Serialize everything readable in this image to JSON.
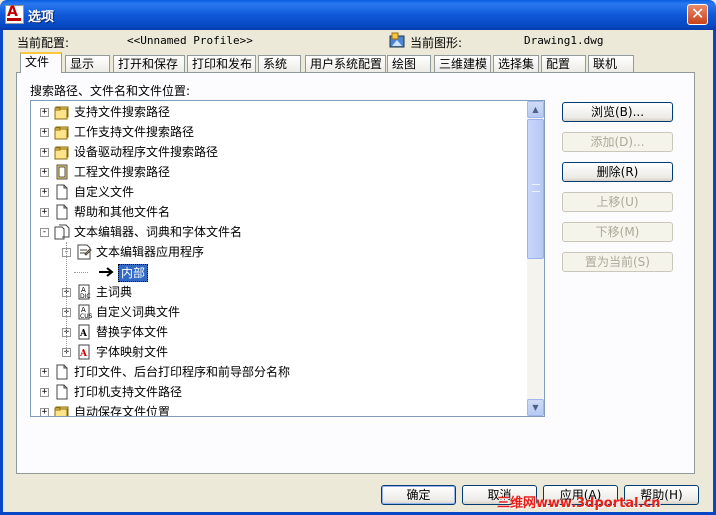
{
  "window": {
    "title": "选项"
  },
  "profile": {
    "label": "当前配置:",
    "value": "<<Unnamed Profile>>"
  },
  "drawing": {
    "label": "当前图形:",
    "value": "Drawing1.dwg"
  },
  "tabs": [
    "文件",
    "显示",
    "打开和保存",
    "打印和发布",
    "系统",
    "用户系统配置",
    "绘图",
    "三维建模",
    "选择集",
    "配置",
    "联机"
  ],
  "active_tab": 0,
  "search_label": "搜索路径、文件名和文件位置:",
  "tree": [
    {
      "label": "支持文件搜索路径",
      "icon": "folder-stack-icon",
      "level": 0,
      "expander": "+"
    },
    {
      "label": "工作支持文件搜索路径",
      "icon": "folder-stack-icon",
      "level": 0,
      "expander": "+"
    },
    {
      "label": "设备驱动程序文件搜索路径",
      "icon": "folder-stack-icon",
      "level": 0,
      "expander": "+"
    },
    {
      "label": "工程文件搜索路径",
      "icon": "project-file-icon",
      "level": 0,
      "expander": "+"
    },
    {
      "label": "自定义文件",
      "icon": "document-icon",
      "level": 0,
      "expander": "+"
    },
    {
      "label": "帮助和其他文件名",
      "icon": "document-icon",
      "level": 0,
      "expander": "+"
    },
    {
      "label": "文本编辑器、词典和字体文件名",
      "icon": "document-stack-icon",
      "level": 0,
      "expander": "-"
    },
    {
      "label": "文本编辑器应用程序",
      "icon": "text-editor-icon",
      "level": 1,
      "expander": "-"
    },
    {
      "label": "内部",
      "icon": "arrow-icon",
      "level": 2,
      "expander": "",
      "selected": true
    },
    {
      "label": "主词典",
      "icon": "dictionary-icon",
      "level": 1,
      "expander": "+"
    },
    {
      "label": "自定义词典文件",
      "icon": "custom-dictionary-icon",
      "level": 1,
      "expander": "+"
    },
    {
      "label": "替换字体文件",
      "icon": "font-file-icon",
      "level": 1,
      "expander": "+"
    },
    {
      "label": "字体映射文件",
      "icon": "font-map-icon",
      "level": 1,
      "expander": "+"
    },
    {
      "label": "打印文件、后台打印程序和前导部分名称",
      "icon": "document-icon",
      "level": 0,
      "expander": "+"
    },
    {
      "label": "打印机支持文件路径",
      "icon": "document-icon",
      "level": 0,
      "expander": "+"
    },
    {
      "label": "自动保存文件位置",
      "icon": "folder-stack-icon",
      "level": 0,
      "expander": "+"
    }
  ],
  "side_buttons": [
    {
      "label": "浏览(B)...",
      "enabled": true
    },
    {
      "label": "添加(D)...",
      "enabled": false
    },
    {
      "label": "删除(R)",
      "enabled": true
    },
    {
      "label": "上移(U)",
      "enabled": false
    },
    {
      "label": "下移(M)",
      "enabled": false
    },
    {
      "label": "置为当前(S)",
      "enabled": false
    }
  ],
  "bottom_buttons": {
    "ok": "确定",
    "cancel": "取消",
    "apply": "应用(A)",
    "help": "帮助(H)"
  },
  "watermark": "三维网www.3dportal.cn",
  "colors": {
    "titlebar": "#0a5fe0",
    "selection": "#316ac5",
    "tab_highlight": "#ffc83c"
  }
}
